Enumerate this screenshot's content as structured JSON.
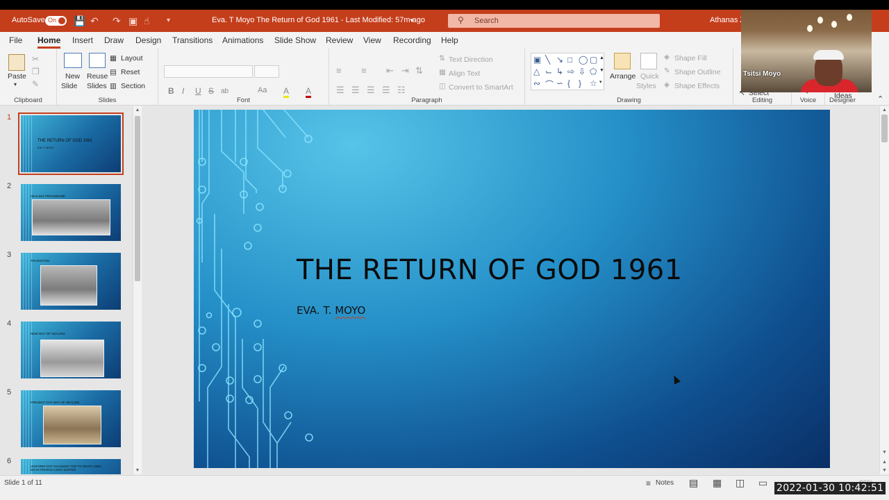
{
  "titlebar": {
    "autosave_label": "AutoSave",
    "autosave_state": "On",
    "document_title": "Eva. T Moyo The Return of God 1961  -  Last Modified: 57m ago",
    "search_placeholder": "Search",
    "user_name": "Athanas Z"
  },
  "menu": {
    "tabs": [
      "File",
      "Home",
      "Insert",
      "Draw",
      "Design",
      "Transitions",
      "Animations",
      "Slide Show",
      "Review",
      "View",
      "Recording",
      "Help"
    ],
    "active_tab": "Home"
  },
  "ribbon": {
    "clipboard": {
      "label": "Clipboard",
      "paste": "Paste"
    },
    "slides": {
      "label": "Slides",
      "new_slide_1": "New",
      "new_slide_2": "Slide",
      "reuse_1": "Reuse",
      "reuse_2": "Slides",
      "layout": "Layout",
      "reset": "Reset",
      "section": "Section"
    },
    "font": {
      "label": "Font",
      "bold": "B",
      "italic": "I",
      "underline": "U",
      "strike": "S",
      "shadow": "ab",
      "case": "Aa",
      "highlight": "A",
      "color": "A"
    },
    "paragraph": {
      "label": "Paragraph",
      "text_direction": "Text Direction",
      "align_text": "Align Text",
      "smartart": "Convert to SmartArt"
    },
    "drawing": {
      "label": "Drawing",
      "arrange": "Arrange",
      "quick_styles_1": "Quick",
      "quick_styles_2": "Styles",
      "shape_fill": "Shape Fill",
      "shape_outline": "Shape Outline",
      "shape_effects": "Shape Effects"
    },
    "editing": {
      "label": "Editing",
      "select": "Select"
    },
    "voice": {
      "label": "Voice"
    },
    "designer": {
      "label": "Designer",
      "ideas": "Ideas"
    }
  },
  "thumbnails": [
    {
      "number": "1",
      "title": "THE RETURN OF GOD 1961",
      "subtitle": "EVA. T. MOYO",
      "selected": true,
      "has_photo": false
    },
    {
      "number": "2",
      "title": "HEALING PROCEDURE",
      "selected": false,
      "has_photo": true
    },
    {
      "number": "3",
      "title": "TRANSITION",
      "selected": false,
      "has_photo": true
    },
    {
      "number": "4",
      "title": "NEW WAY OF HEALING",
      "selected": false,
      "has_photo": true
    },
    {
      "number": "5",
      "title": "PRESENT DAY WAY OF HEALING",
      "selected": false,
      "has_photo": true
    },
    {
      "number": "6",
      "title": "UNIFORM GOT CHANGED TOO TO WHAT LONG WAYS PEOPLE LONG SUFFER",
      "selected": false,
      "has_photo": false
    }
  ],
  "slide": {
    "title": "THE RETURN OF GOD 1961",
    "subtitle_prefix": "EVA. T. ",
    "subtitle_surname": "MOYO"
  },
  "statusbar": {
    "slide_position": "Slide 1 of 11",
    "notes": "Notes",
    "zoom": "86%"
  },
  "webcam": {
    "participant_name": "Tsitsi Moyo"
  },
  "overlay": {
    "timestamp": "2022-01-30  10:42:51"
  },
  "colors": {
    "accent": "#c43e1c",
    "slide_light": "#56c4e8",
    "slide_dark": "#0a2f66"
  }
}
